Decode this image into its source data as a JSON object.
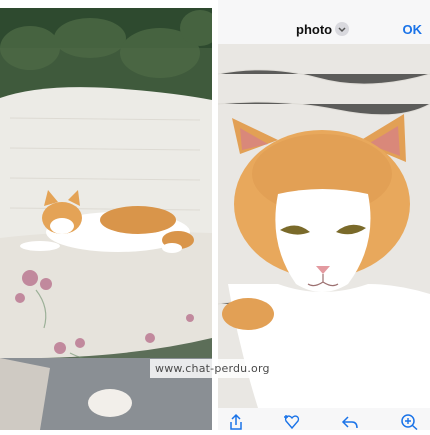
{
  "left_photo": {
    "icon": "cat-on-bench-photo"
  },
  "editor": {
    "title": "photo",
    "title_chevron_icon": "chevron-down-icon",
    "ok_label": "OK",
    "accent_color": "#1a73e8",
    "toolbar": {
      "items": [
        {
          "name": "share-icon"
        },
        {
          "name": "favorite-add-icon"
        },
        {
          "name": "reply-icon"
        },
        {
          "name": "zoom-in-icon"
        }
      ]
    }
  },
  "watermark": {
    "text": "www.chat-perdu.org"
  }
}
